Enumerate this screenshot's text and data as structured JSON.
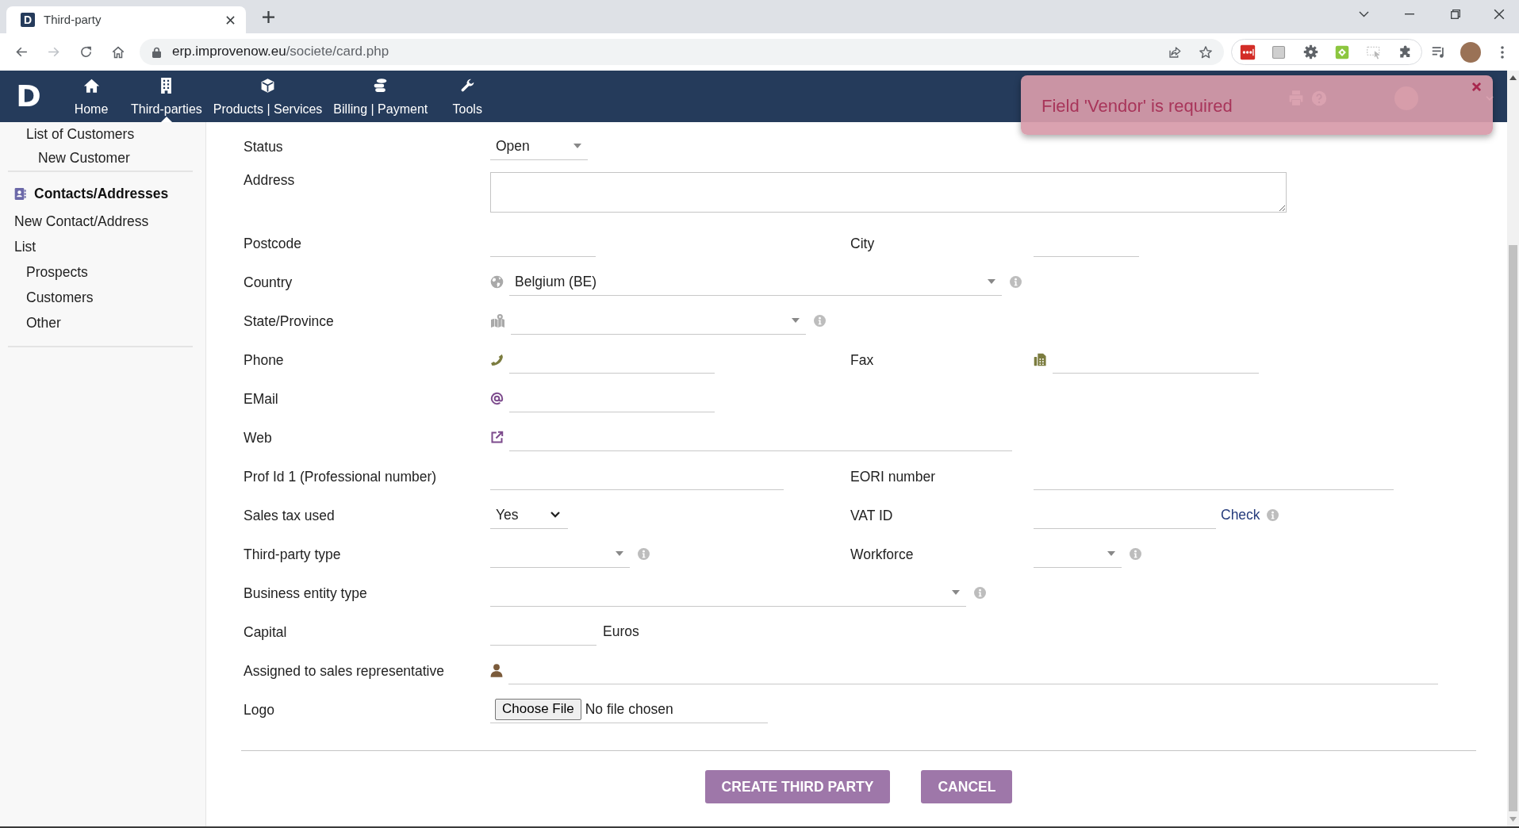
{
  "browser": {
    "tab": {
      "favicon": "D",
      "title": "Third-party"
    },
    "address_bar": {
      "host": "erp.improvenow.eu",
      "path": "/societe/card.php"
    }
  },
  "top_nav": {
    "logo": "D",
    "items": [
      {
        "label": "Home",
        "selected": false
      },
      {
        "label": "Third-parties",
        "selected": true
      },
      {
        "label": "Products | Services",
        "selected": false
      },
      {
        "label": "Billing | Payment",
        "selected": false
      },
      {
        "label": "Tools",
        "selected": false
      }
    ]
  },
  "notification": {
    "message": "Field 'Vendor' is required"
  },
  "sidebar": {
    "sections": [
      {
        "items": [
          {
            "label": "List of Customers",
            "children": [
              {
                "label": "New Customer"
              }
            ]
          }
        ]
      },
      {
        "heading": "Contacts/Addresses",
        "items": [
          {
            "label": "New Contact/Address"
          },
          {
            "label": "List",
            "children": [
              {
                "label": "Prospects"
              },
              {
                "label": "Customers"
              },
              {
                "label": "Other"
              }
            ]
          }
        ]
      }
    ]
  },
  "form": {
    "rows": [
      {
        "label": "Status",
        "control": {
          "kind": "select",
          "value": "Open"
        }
      },
      {
        "label": "Address",
        "control": {
          "kind": "textarea"
        }
      },
      {
        "label": "Postcode",
        "control": {
          "kind": "text"
        },
        "right": {
          "label": "City",
          "control": {
            "kind": "text"
          }
        }
      },
      {
        "label": "Country",
        "control": {
          "kind": "select",
          "value": "Belgium (BE)",
          "help": true
        }
      },
      {
        "label": "State/Province",
        "control": {
          "kind": "select",
          "help": true
        }
      },
      {
        "label": "Phone",
        "control": {
          "kind": "text"
        },
        "right": {
          "label": "Fax",
          "control": {
            "kind": "text"
          }
        }
      },
      {
        "label": "EMail",
        "control": {
          "kind": "text"
        }
      },
      {
        "label": "Web",
        "control": {
          "kind": "text"
        }
      },
      {
        "label": "Prof Id 1 (Professional number)",
        "control": {
          "kind": "text"
        },
        "right": {
          "label": "EORI number",
          "control": {
            "kind": "text"
          }
        }
      },
      {
        "label": "Sales tax used",
        "control": {
          "kind": "native-select",
          "value": "Yes"
        },
        "right": {
          "label": "VAT ID",
          "control": {
            "kind": "text",
            "link": "Check",
            "help": true
          }
        }
      },
      {
        "label": "Third-party type",
        "control": {
          "kind": "select",
          "help": true
        },
        "right": {
          "label": "Workforce",
          "control": {
            "kind": "select",
            "help": true
          }
        }
      },
      {
        "label": "Business entity type",
        "control": {
          "kind": "select",
          "help": true
        }
      },
      {
        "label": "Capital",
        "control": {
          "kind": "text",
          "suffix": "Euros"
        }
      },
      {
        "label": "Assigned to sales representative",
        "control": {
          "kind": "text"
        }
      },
      {
        "label": "Logo",
        "control": {
          "kind": "file",
          "button": "Choose File",
          "status": "No file chosen"
        }
      }
    ]
  },
  "actions": [
    {
      "label": "CREATE THIRD PARTY"
    },
    {
      "label": "CANCEL"
    }
  ]
}
